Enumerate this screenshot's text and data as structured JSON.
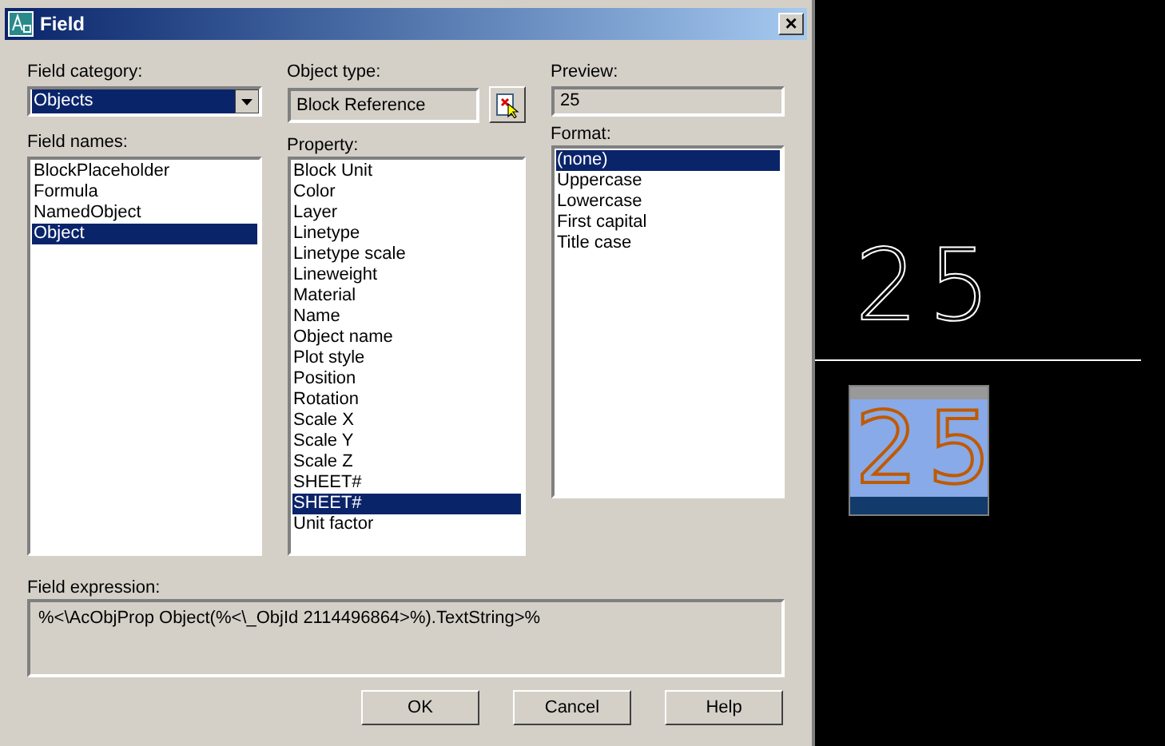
{
  "window": {
    "title": "Field",
    "close": "×"
  },
  "field_category": {
    "label": "Field category:",
    "value": "Objects"
  },
  "field_names": {
    "label": "Field names:",
    "items": [
      {
        "label": "BlockPlaceholder",
        "selected": false
      },
      {
        "label": "Formula",
        "selected": false
      },
      {
        "label": "NamedObject",
        "selected": false
      },
      {
        "label": "Object",
        "selected": true
      }
    ]
  },
  "object_type": {
    "label": "Object type:",
    "value": "Block Reference"
  },
  "property": {
    "label": "Property:",
    "items": [
      {
        "label": "Block Unit",
        "selected": false
      },
      {
        "label": "Color",
        "selected": false
      },
      {
        "label": "Layer",
        "selected": false
      },
      {
        "label": "Linetype",
        "selected": false
      },
      {
        "label": "Linetype scale",
        "selected": false
      },
      {
        "label": "Lineweight",
        "selected": false
      },
      {
        "label": "Material",
        "selected": false
      },
      {
        "label": "Name",
        "selected": false
      },
      {
        "label": "Object name",
        "selected": false
      },
      {
        "label": "Plot style",
        "selected": false
      },
      {
        "label": "Position",
        "selected": false
      },
      {
        "label": "Rotation",
        "selected": false
      },
      {
        "label": "Scale X",
        "selected": false
      },
      {
        "label": "Scale Y",
        "selected": false
      },
      {
        "label": "Scale Z",
        "selected": false
      },
      {
        "label": "SHEET#",
        "selected": false
      },
      {
        "label": "SHEET#",
        "selected": true
      },
      {
        "label": "Unit factor",
        "selected": false
      }
    ]
  },
  "preview": {
    "label": "Preview:",
    "value": "25"
  },
  "format": {
    "label": "Format:",
    "items": [
      {
        "label": "(none)",
        "selected": true
      },
      {
        "label": "Uppercase",
        "selected": false
      },
      {
        "label": "Lowercase",
        "selected": false
      },
      {
        "label": "First capital",
        "selected": false
      },
      {
        "label": "Title case",
        "selected": false
      }
    ]
  },
  "field_expression": {
    "label": "Field expression:",
    "value": "%<\\AcObjProp Object(%<\\_ObjId 2114496864>%).TextString>%"
  },
  "buttons": [
    "OK",
    "Cancel",
    "Help"
  ],
  "drawing": {
    "texts": [
      {
        "text": "25",
        "selected": false
      },
      {
        "text": "25",
        "selected": true
      }
    ]
  }
}
